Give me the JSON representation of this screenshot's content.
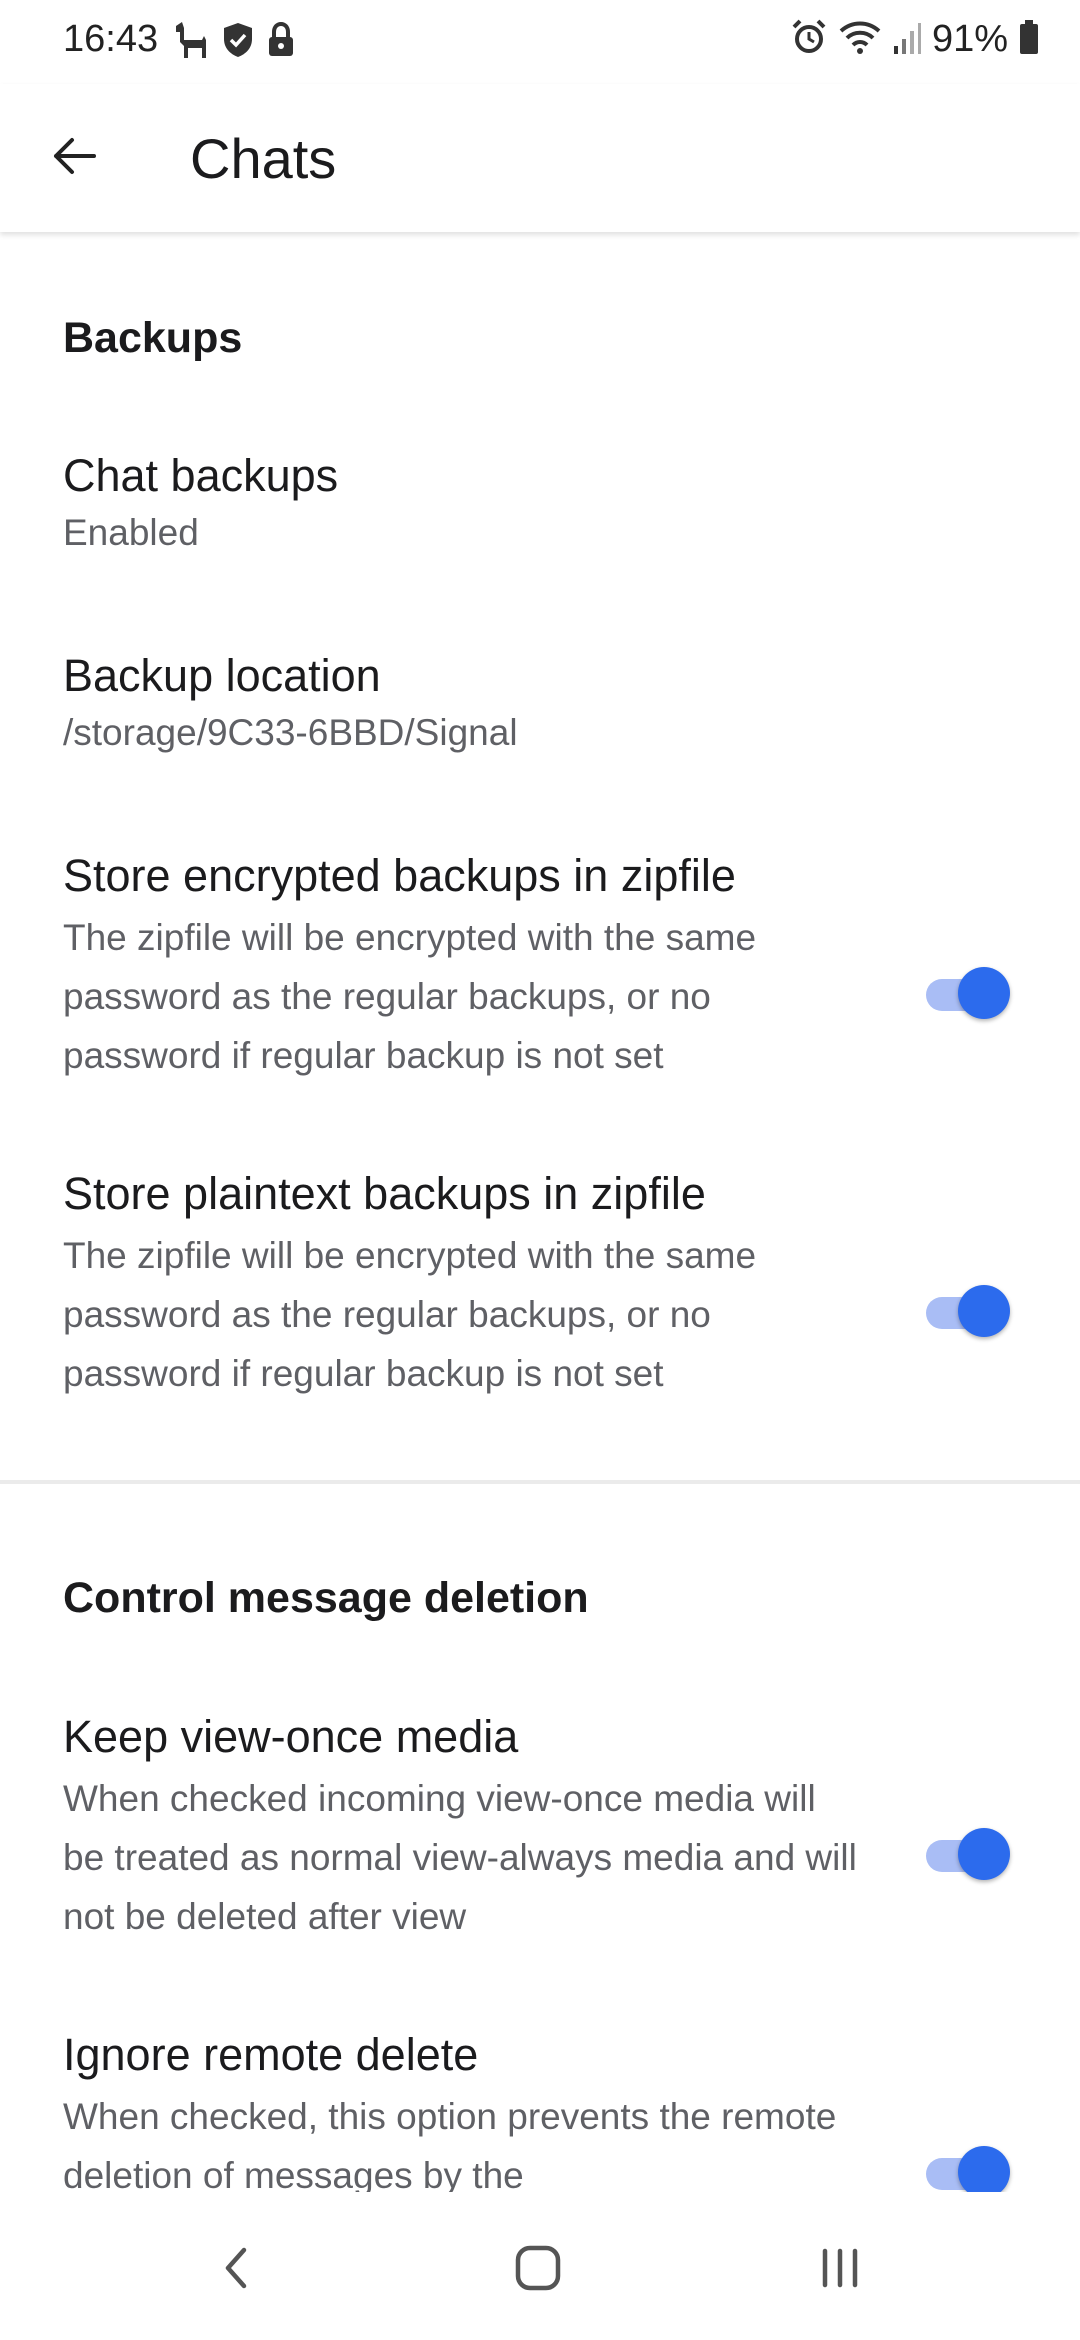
{
  "status_bar": {
    "time": "16:43",
    "battery": "91%",
    "icons_left": [
      "llama-icon",
      "shield-check-icon",
      "lock-icon"
    ],
    "icons_right": [
      "alarm-icon",
      "wifi-icon",
      "signal-icon",
      "battery-icon"
    ]
  },
  "app_bar": {
    "title": "Chats",
    "back_icon": "arrow-back-icon"
  },
  "sections": {
    "backups": {
      "header": "Backups",
      "chat_backups": {
        "title": "Chat backups",
        "summary": "Enabled"
      },
      "backup_location": {
        "title": "Backup location",
        "summary": "/storage/9C33-6BBD/Signal"
      },
      "encrypted_zip": {
        "title": "Store encrypted backups in zipfile",
        "summary": "The zipfile will be encrypted with the same password as the regular backups, or no password if regular backup is not set",
        "enabled": true
      },
      "plaintext_zip": {
        "title": "Store plaintext backups in zipfile",
        "summary": "The zipfile will be encrypted with the same password as the regular backups, or no password if regular backup is not set",
        "enabled": true
      }
    },
    "message_deletion": {
      "header": "Control message deletion",
      "keep_view_once": {
        "title": "Keep view-once media",
        "summary": "When checked incoming view-once media will be treated as normal view-always media and will not be deleted after view",
        "enabled": true
      },
      "ignore_remote_delete": {
        "title": "Ignore remote delete",
        "summary": "When checked, this option prevents the remote deletion of messages by the",
        "enabled": true
      }
    }
  },
  "colors": {
    "accent": "#2c6bed",
    "track": "#a9bdf5",
    "text_primary": "#1b1b1d",
    "text_secondary": "#5f6065"
  },
  "nav_bar": {
    "icons": [
      "nav-back-icon",
      "nav-home-icon",
      "nav-recents-icon"
    ]
  }
}
